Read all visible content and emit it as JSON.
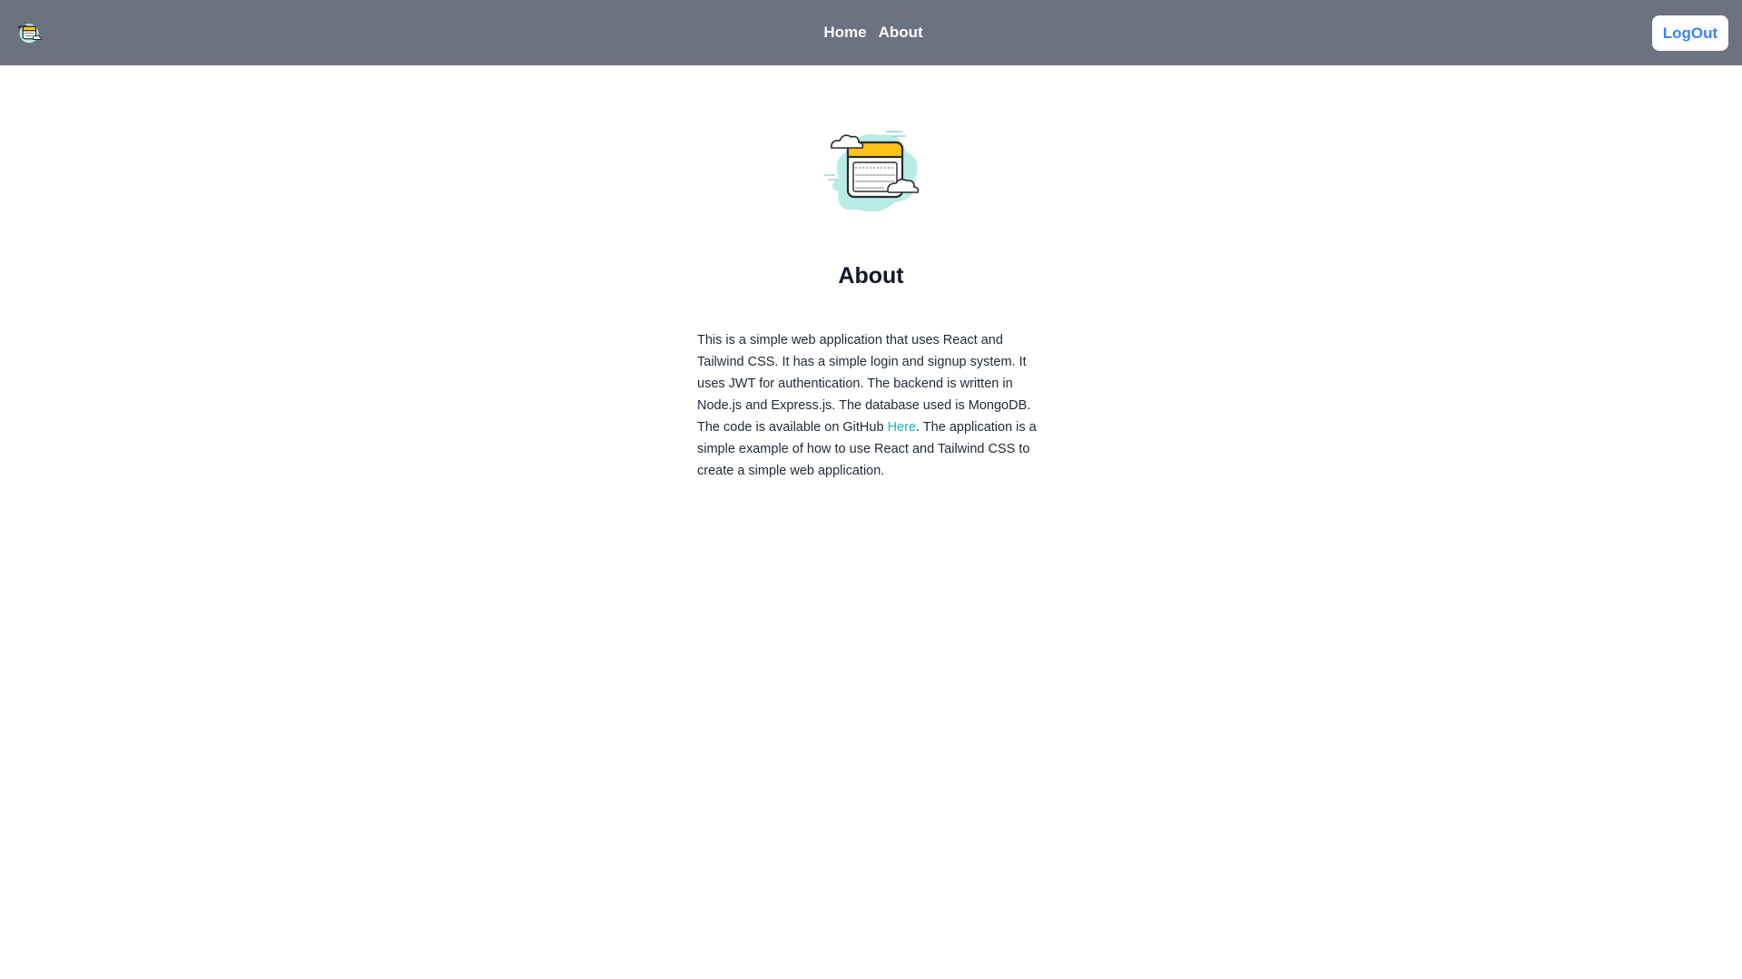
{
  "nav": {
    "logo_icon": "clouds-calendar-logo-icon",
    "links": [
      {
        "label": "Home"
      },
      {
        "label": "About"
      }
    ],
    "logout_label": "LogOut"
  },
  "main": {
    "hero_icon": "clouds-calendar-illustration-icon",
    "title": "About",
    "paragraph": {
      "text_before_link": "This is a simple web application that uses React and Tailwind CSS. It has a simple login and signup system. It uses JWT for authentication. The backend is written in Node.js and Express.js. The database used is MongoDB. The code is available on GitHub ",
      "link_label": "Here",
      "text_after_link": ". The application is a simple example of how to use React and Tailwind CSS to create a simple web application."
    }
  },
  "colors": {
    "navbar_bg": "#6b7280",
    "logout_text": "#3b82f6",
    "link_accent": "#14b8c4",
    "illustration_cloud": "#b9ece6",
    "illustration_yellow": "#fcc419"
  }
}
